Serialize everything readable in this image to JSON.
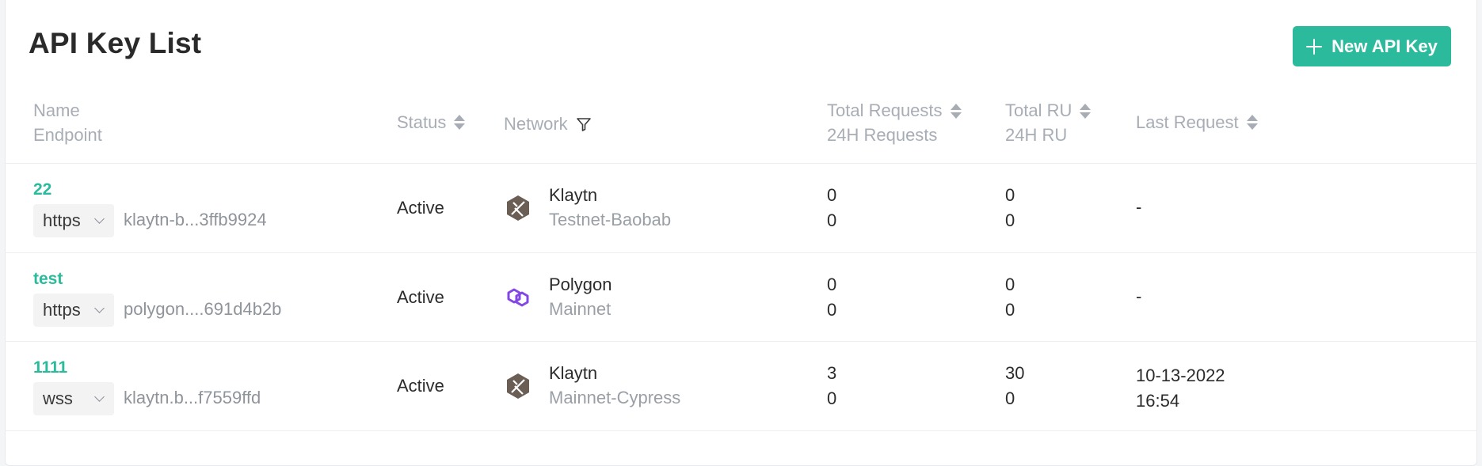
{
  "page": {
    "title": "API Key List",
    "new_button_label": "New API Key"
  },
  "columns": {
    "name": "Name",
    "endpoint": "Endpoint",
    "status": "Status",
    "network": "Network",
    "total_requests": "Total Requests",
    "requests_24h": "24H Requests",
    "total_ru": "Total RU",
    "ru_24h": "24H RU",
    "last_request": "Last Request"
  },
  "rows": [
    {
      "name": "22",
      "protocol": "https",
      "endpoint": "klaytn-b...3ffb9924",
      "status": "Active",
      "network_icon": "klaytn-icon",
      "network": "Klaytn",
      "network_sub": "Testnet-Baobab",
      "total_requests": "0",
      "requests_24h": "0",
      "total_ru": "0",
      "ru_24h": "0",
      "last_request_line1": "-",
      "last_request_line2": ""
    },
    {
      "name": "test",
      "protocol": "https",
      "endpoint": "polygon....691d4b2b",
      "status": "Active",
      "network_icon": "polygon-icon",
      "network": "Polygon",
      "network_sub": "Mainnet",
      "total_requests": "0",
      "requests_24h": "0",
      "total_ru": "0",
      "ru_24h": "0",
      "last_request_line1": "-",
      "last_request_line2": ""
    },
    {
      "name": "1111",
      "protocol": "wss",
      "endpoint": "klaytn.b...f7559ffd",
      "status": "Active",
      "network_icon": "klaytn-icon",
      "network": "Klaytn",
      "network_sub": "Mainnet-Cypress",
      "total_requests": "3",
      "requests_24h": "0",
      "total_ru": "30",
      "ru_24h": "0",
      "last_request_line1": "10-13-2022",
      "last_request_line2": "16:54"
    }
  ],
  "colors": {
    "accent": "#2bbb9c",
    "header_text": "#a8adb5",
    "polygon": "#8247e5",
    "klaytn": "#6b5f55"
  }
}
